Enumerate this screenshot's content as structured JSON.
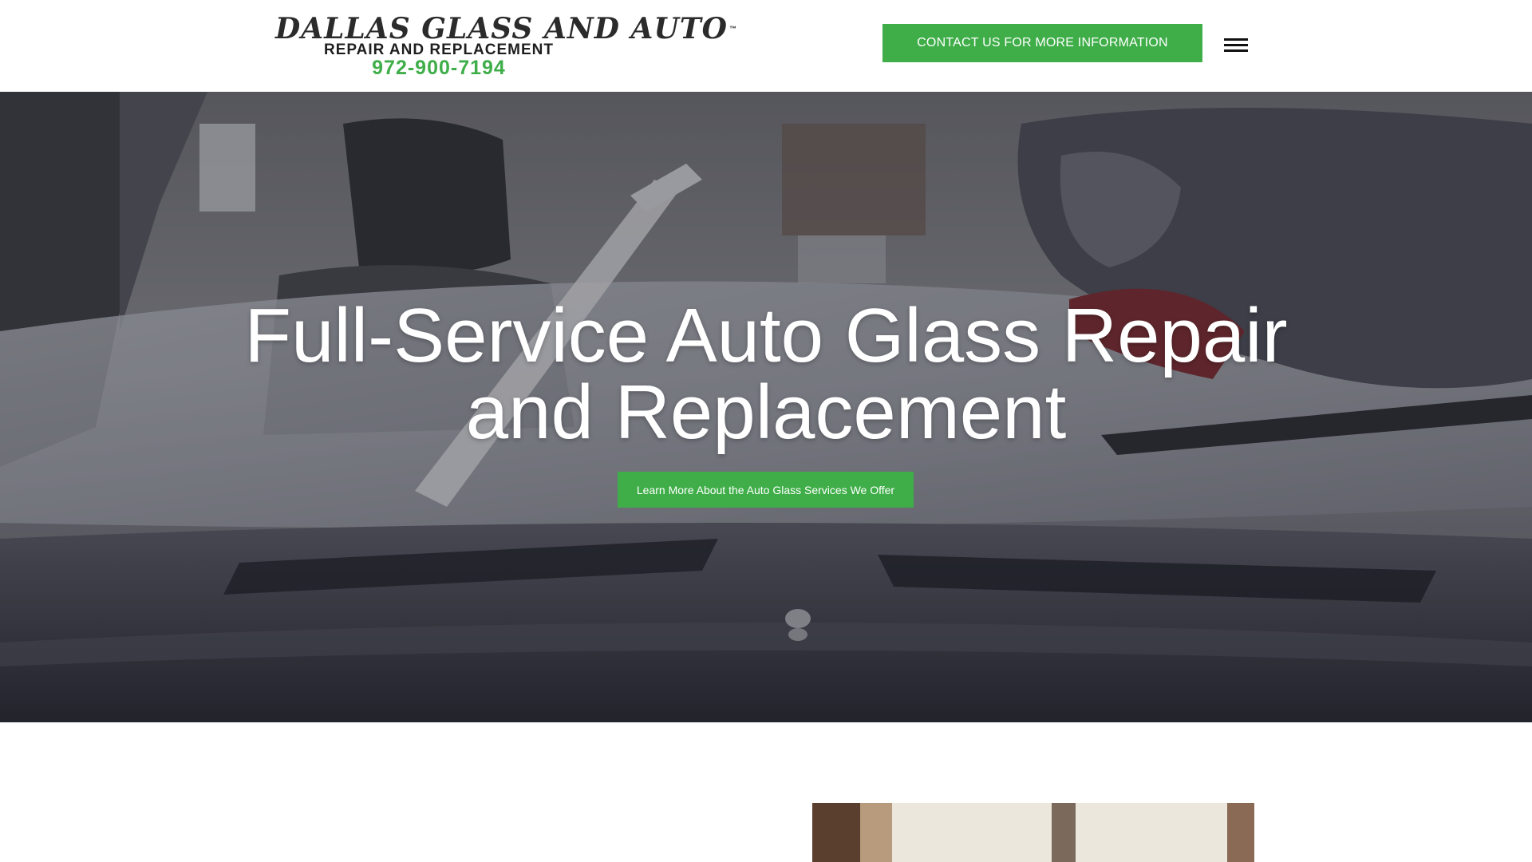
{
  "header": {
    "logo": {
      "name": "DALLAS GLASS AND AUTO",
      "trademark": "™",
      "tagline": "REPAIR AND REPLACEMENT",
      "phone": "972-900-7194"
    },
    "contact_button_label": "CONTACT US FOR MORE INFORMATION",
    "menu_icon": "hamburger-menu-icon"
  },
  "hero": {
    "title_line1": "Full-Service Auto Glass Repair",
    "title_line2": "and Replacement",
    "button_label": "Learn More About the Auto Glass Services We Offer"
  },
  "colors": {
    "brand_green": "#3fae49",
    "header_background": "#ffffff",
    "hero_text": "#ffffff",
    "logo_text": "#2b2b2b"
  }
}
